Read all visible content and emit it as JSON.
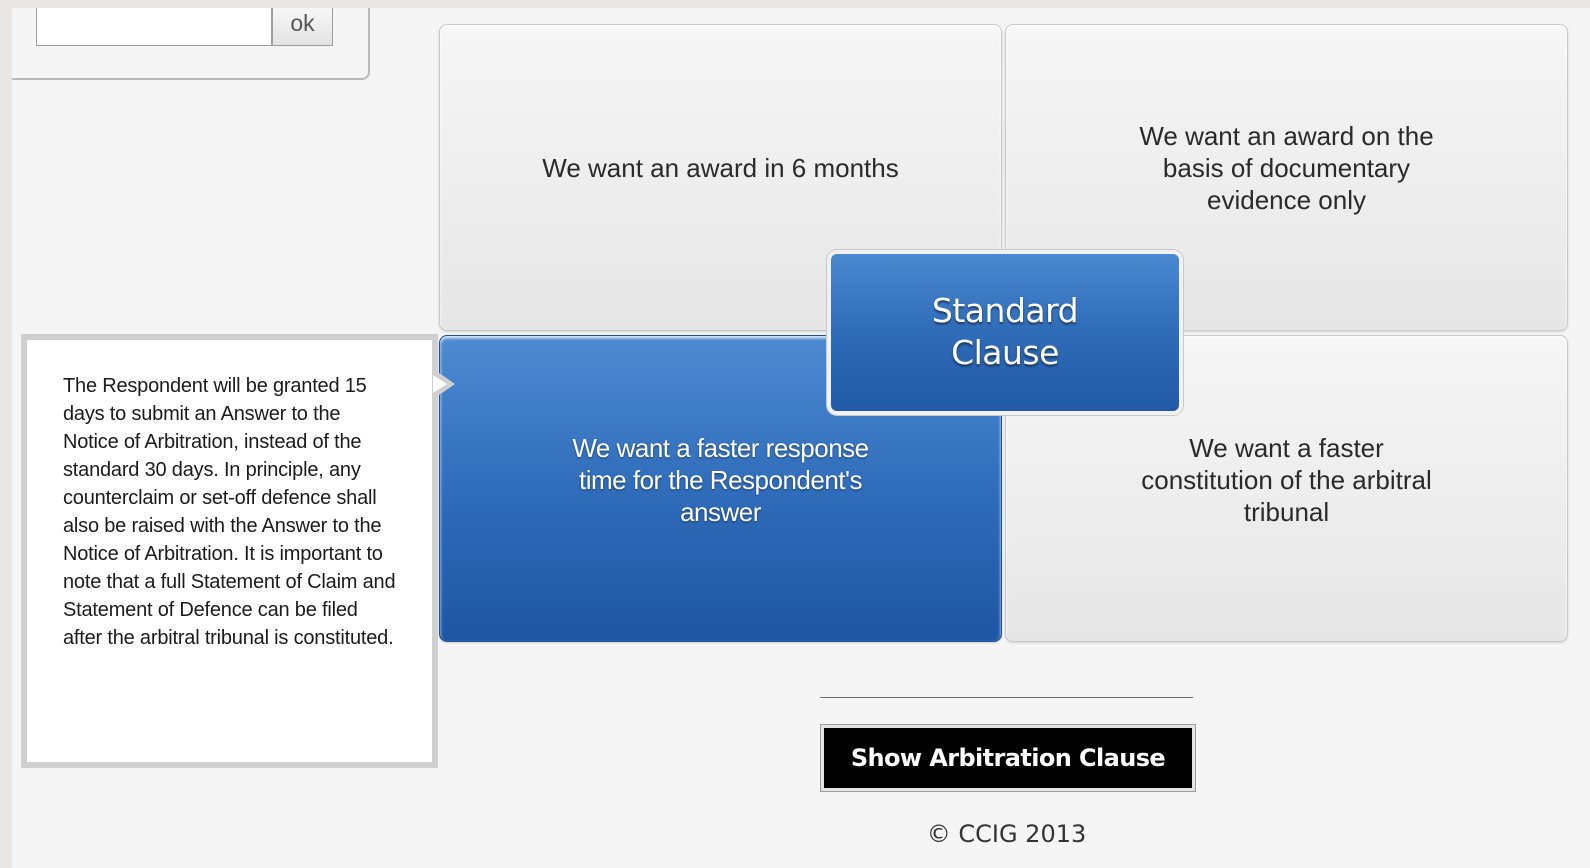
{
  "search": {
    "value": "",
    "placeholder": "",
    "ok_label": "ok"
  },
  "options": {
    "award_6_months": "We want an award in 6 months",
    "documentary_evidence": "We want an award on the basis of documentary evidence only",
    "faster_response": "We want a faster response time for the Respondent's answer",
    "faster_constitution": "We want a faster constitution of the arbitral tribunal"
  },
  "standard_clause": {
    "line1": "Standard",
    "line2": "Clause"
  },
  "info": {
    "text": "The Respondent will be granted 15 days to submit an Answer to the Notice of Arbitration, instead of the standard 30 days. In principle, any counterclaim or set-off defence shall also be raised with the Answer to the Notice of Arbitration. It is important to note that a full Statement of Claim and Statement of Defence can be filed after the arbitral tribunal is constituted."
  },
  "footer": {
    "show_button_label": "Show Arbitration Clause",
    "copyright": "© CCIG 2013"
  },
  "colors": {
    "selected_blue": "#2d6ab8",
    "tile_grey": "#e6e6e6",
    "button_black": "#000000"
  }
}
